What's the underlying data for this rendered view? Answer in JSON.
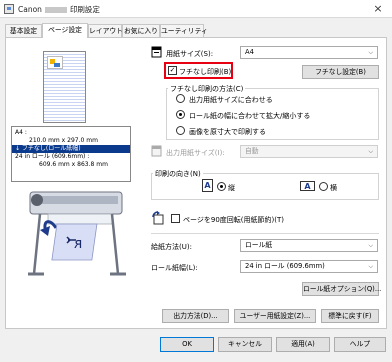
{
  "window": {
    "brand": "Canon",
    "title": "印刷設定",
    "close": "×"
  },
  "tabs": [
    "基本設定",
    "ページ設定",
    "レイアウト",
    "お気に入り",
    "ユーティリティ"
  ],
  "preview": {
    "media": {
      "line1": "A4 :",
      "line2": "210.0 mm x 297.0 mm",
      "line3": "↓ フチなし(ロール紙幅)",
      "line4": "24 in ロール (609.6mm) :",
      "line5": "609.6 mm x 863.8 mm"
    }
  },
  "page_size": {
    "label": "用紙サイズ(S):",
    "value": "A4"
  },
  "borderless": {
    "label": "フチなし印刷(B)",
    "checked": true,
    "settings_button": "フチなし設定(B)"
  },
  "borderless_method": {
    "title": "フチなし印刷の方法(C)",
    "options": [
      {
        "label": "出力用紙サイズに合わせる",
        "selected": false
      },
      {
        "label": "ロール紙の幅に合わせて拡大/縮小する",
        "selected": true
      },
      {
        "label": "画像を原寸大で印刷する",
        "selected": false
      }
    ]
  },
  "output_size": {
    "label": "出力用紙サイズ(I):",
    "value": "自動"
  },
  "orientation": {
    "title": "印刷の向き(N)",
    "portrait_glyph": "A",
    "portrait": "縦",
    "landscape_glyph": "A",
    "landscape": "横",
    "selected": "portrait"
  },
  "rotate90": {
    "label": "ページを90度回転(用紙節約)(T)",
    "checked": false
  },
  "feed_method": {
    "label": "給紙方法(U):",
    "value": "ロール紙"
  },
  "roll_width": {
    "label": "ロール紙幅(L):",
    "value": "24 in ロール (609.6mm)"
  },
  "roll_options_button": "ロール紙オプション(Q)...",
  "action_buttons": {
    "output_method": "出力方法(D)...",
    "custom_size": "ユーザー用紙設定(Z)...",
    "defaults": "標準に戻す(F)"
  },
  "dialog_buttons": {
    "ok": "OK",
    "cancel": "キャンセル",
    "apply": "適用(A)",
    "help": "ヘルプ"
  },
  "colors": {
    "accent": "#0b3a8c",
    "highlight": "#e60012",
    "selection": "#0b3a8c"
  },
  "icons": [
    "app-printer-icon",
    "close-icon",
    "page-size-icon",
    "output-size-icon",
    "rotate-page-icon",
    "portrait-icon",
    "landscape-icon",
    "printer-illustration"
  ]
}
